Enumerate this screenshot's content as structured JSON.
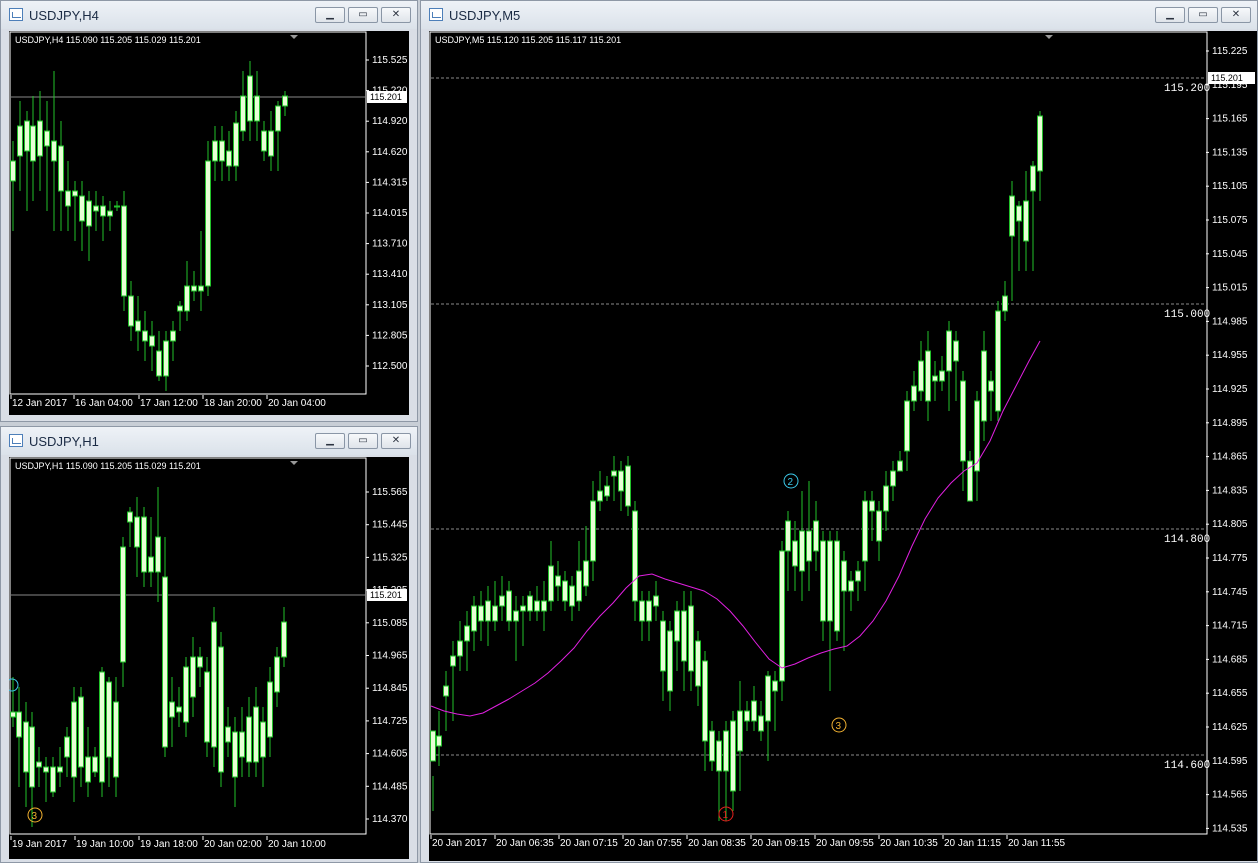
{
  "windows": {
    "h4": {
      "title": "USDJPY,H4",
      "info": "USDJPY,H4  115.090 115.205 115.029 115.201",
      "price_labels": [
        "115.525",
        "115.220",
        "114.920",
        "114.620",
        "114.315",
        "114.015",
        "113.710",
        "113.410",
        "113.105",
        "112.805",
        "112.500"
      ],
      "current_price": "115.201",
      "time_labels": [
        "12 Jan 2017",
        "16 Jan 04:00",
        "17 Jan 12:00",
        "18 Jan 20:00",
        "20 Jan 04:00"
      ]
    },
    "h1": {
      "title": "USDJPY,H1",
      "info": "USDJPY,H1  115.090 115.205 115.029 115.201",
      "price_labels": [
        "115.565",
        "115.445",
        "115.325",
        "115.205",
        "115.085",
        "114.965",
        "114.845",
        "114.725",
        "114.605",
        "114.485",
        "114.370"
      ],
      "current_price": "115.201",
      "time_labels": [
        "19 Jan 2017",
        "19 Jan 10:00",
        "19 Jan 18:00",
        "20 Jan 02:00",
        "20 Jan 10:00"
      ],
      "markers": [
        "3"
      ]
    },
    "m5": {
      "title": "USDJPY,M5",
      "info": "USDJPY,M5  115.120 115.205 115.117 115.201",
      "price_labels": [
        "115.225",
        "115.195",
        "115.165",
        "115.135",
        "115.105",
        "115.075",
        "115.045",
        "115.015",
        "114.985",
        "114.955",
        "114.925",
        "114.895",
        "114.865",
        "114.835",
        "114.805",
        "114.775",
        "114.745",
        "114.715",
        "114.685",
        "114.655",
        "114.625",
        "114.595",
        "114.565",
        "114.535"
      ],
      "current_price": "115.201",
      "level_labels": [
        "115.200",
        "115.000",
        "114.800",
        "114.600"
      ],
      "time_labels": [
        "20 Jan 2017",
        "20 Jan 06:35",
        "20 Jan 07:15",
        "20 Jan 07:55",
        "20 Jan 08:35",
        "20 Jan 09:15",
        "20 Jan 09:55",
        "20 Jan 10:35",
        "20 Jan 11:15",
        "20 Jan 11:55"
      ],
      "markers": [
        "1",
        "2",
        "3"
      ]
    }
  },
  "window_buttons": {
    "minimize": "▁",
    "maximize": "▭",
    "close": "✕"
  },
  "colors": {
    "background": "#000000",
    "candle": "#22c22a",
    "bull_body": "#000000",
    "bear_body": "#e8ffd6",
    "moving_average": "#e020e0",
    "grid_level": "#8a8a8a",
    "marker_1": "#e0201c",
    "marker_2": "#3cc8e8",
    "marker_3": "#f0b030"
  }
}
